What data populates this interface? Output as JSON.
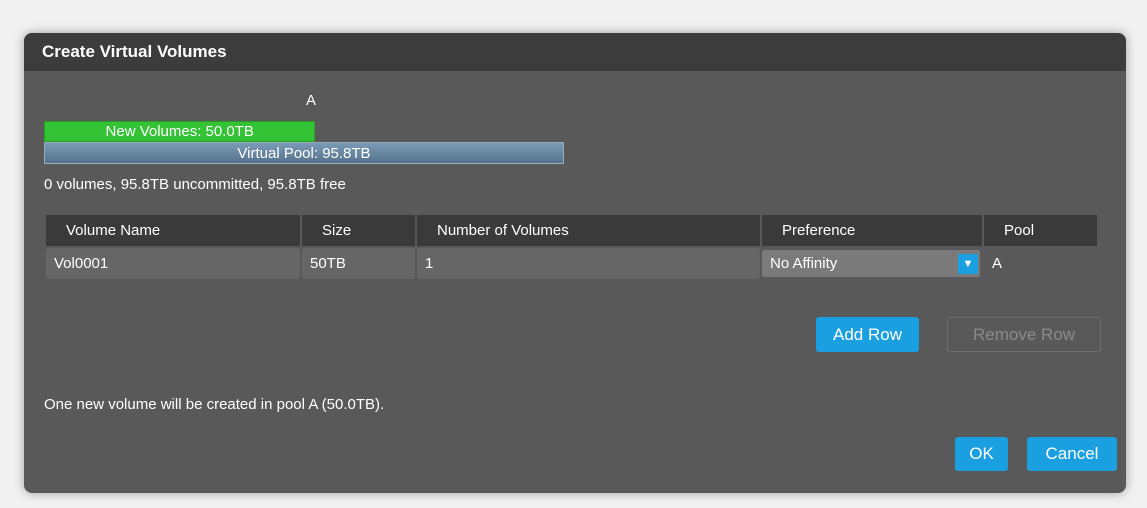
{
  "dialog": {
    "title": "Create Virtual Volumes"
  },
  "capacity": {
    "pool_label": "A",
    "new_volumes_label": "New Volumes: 50.0TB",
    "virtual_pool_label": "Virtual Pool: 95.8TB",
    "new_volumes_fraction": 0.522,
    "summary": "0 volumes, 95.8TB uncommitted, 95.8TB free"
  },
  "table": {
    "headers": {
      "volume_name": "Volume Name",
      "size": "Size",
      "number_of_volumes": "Number of Volumes",
      "preference": "Preference",
      "pool": "Pool"
    },
    "rows": [
      {
        "volume_name": "Vol0001",
        "size": "50TB",
        "number_of_volumes": "1",
        "preference": "No Affinity",
        "pool": "A"
      }
    ]
  },
  "buttons": {
    "add_row": "Add Row",
    "remove_row": "Remove Row",
    "ok": "OK",
    "cancel": "Cancel"
  },
  "message": "One new volume will be created in pool A (50.0TB).",
  "colors": {
    "accent": "#1aa0e1",
    "new_volumes_bar": "#34c334",
    "dialog_bg": "#595959",
    "titlebar_bg": "#3c3c3c"
  }
}
